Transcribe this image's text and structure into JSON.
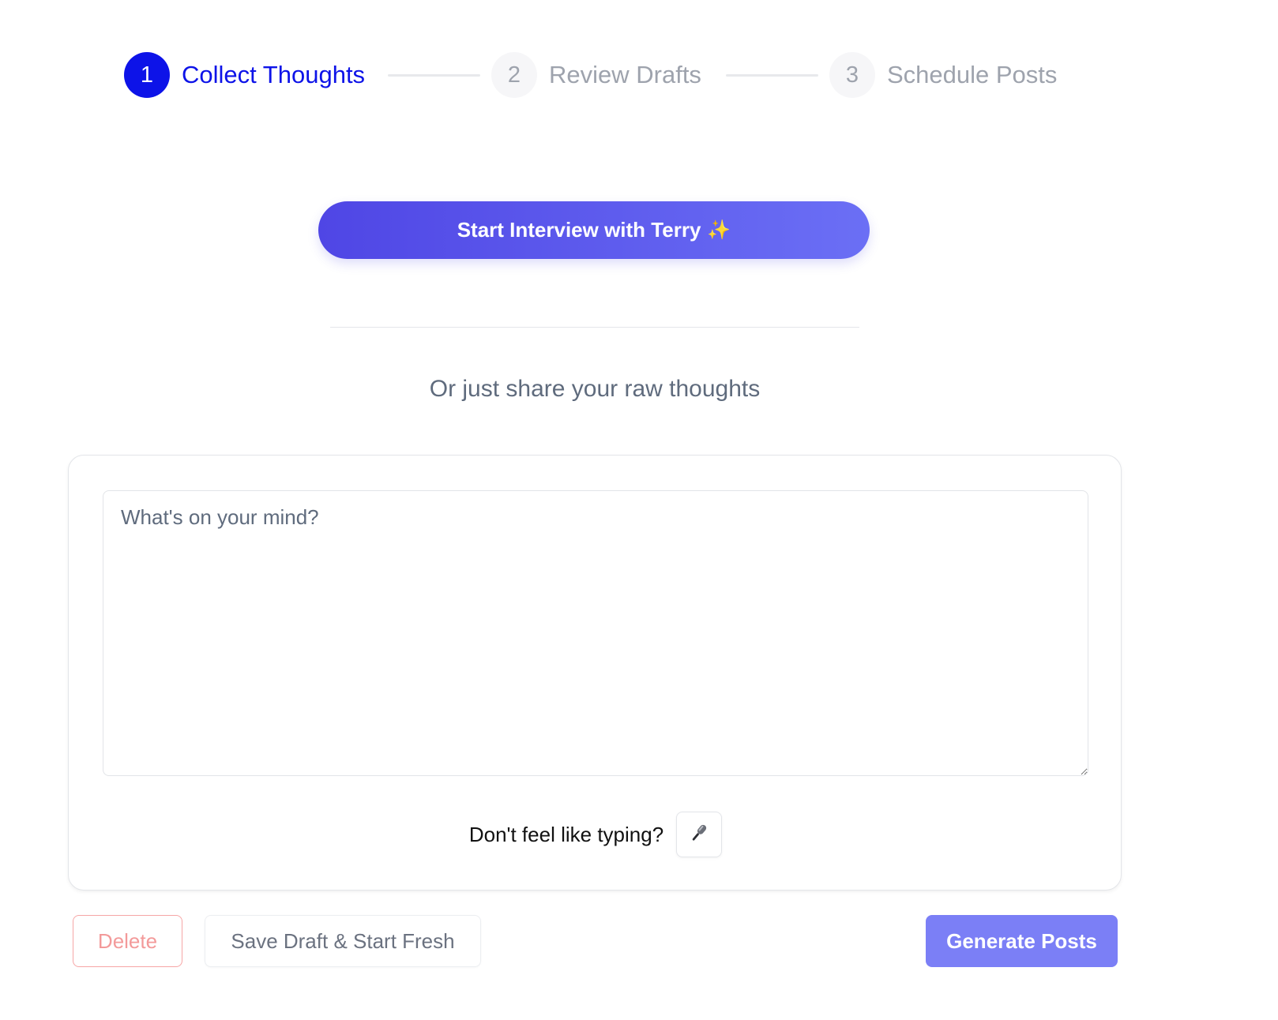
{
  "stepper": {
    "steps": [
      {
        "number": "1",
        "label": "Collect Thoughts",
        "state": "active"
      },
      {
        "number": "2",
        "label": "Review Drafts",
        "state": "inactive"
      },
      {
        "number": "3",
        "label": "Schedule Posts",
        "state": "inactive"
      }
    ]
  },
  "interview": {
    "button_label": "Start Interview with Terry",
    "sparkle": "✨"
  },
  "subheading": "Or just share your raw thoughts",
  "thoughts": {
    "placeholder": "What's on your mind?",
    "value": ""
  },
  "voice": {
    "label": "Don't feel like typing?",
    "icon": "microphone-icon"
  },
  "actions": {
    "delete_label": "Delete",
    "save_label": "Save Draft & Start Fresh",
    "generate_label": "Generate Posts"
  },
  "colors": {
    "primary": "#0d13e8",
    "accent_gradient_start": "#4f46e5",
    "accent_gradient_end": "#6b6ff5",
    "generate_button": "#7b7ff6",
    "inactive_text": "#9ea3ad",
    "danger_text": "#f39a9a"
  }
}
